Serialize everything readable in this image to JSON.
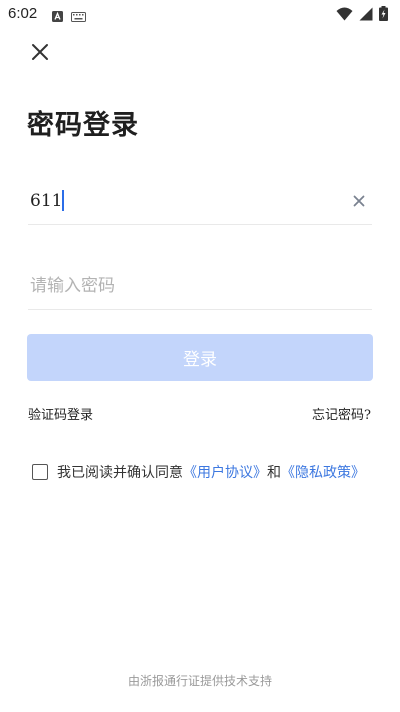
{
  "status_bar": {
    "time": "6:02",
    "icons": [
      "notification-a-icon",
      "keyboard-icon",
      "wifi-icon",
      "signal-icon",
      "battery-charging-icon"
    ]
  },
  "header": {
    "close_icon": "close-icon",
    "title": "密码登录"
  },
  "form": {
    "account_value": "611",
    "account_clear_icon": "clear-icon",
    "password_placeholder": "请输入密码",
    "login_label": "登录"
  },
  "links": {
    "sms_login": "验证码登录",
    "forgot_password": "忘记密码?"
  },
  "agreement": {
    "checked": false,
    "text_prefix": "我已阅读并确认同意",
    "user_agreement": "《用户协议》",
    "conjunction": "和",
    "privacy_policy": "《隐私政策》"
  },
  "footer": {
    "text": "由浙报通行证提供技术支持"
  },
  "colors": {
    "accent": "#3d78e0",
    "login_disabled": "#c3d5fb",
    "caret": "#2b6de8"
  }
}
